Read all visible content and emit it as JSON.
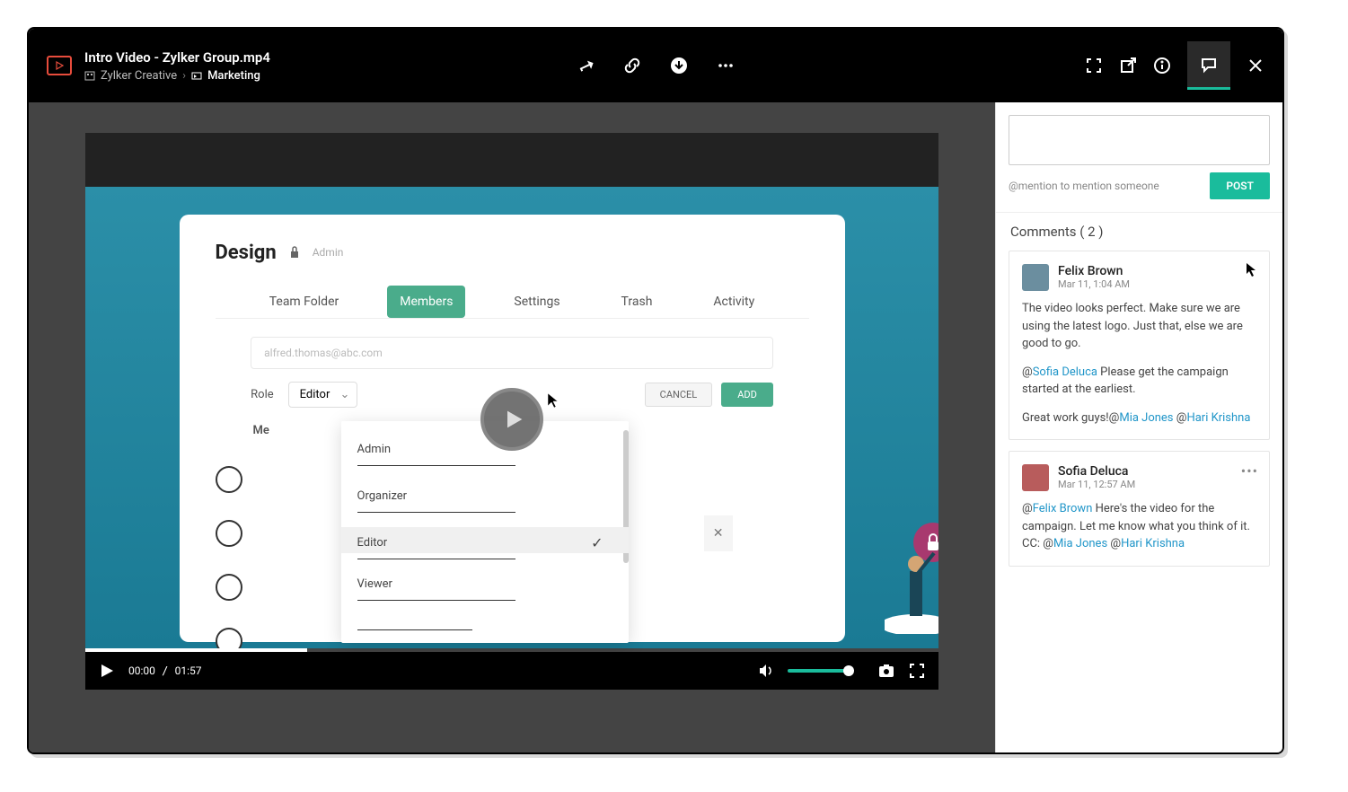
{
  "header": {
    "title": "Intro Video - Zylker Group.mp4",
    "breadcrumb": {
      "org": "Zylker Creative",
      "folder": "Marketing"
    }
  },
  "video": {
    "time_current": "00:00",
    "time_total": "01:57",
    "mock": {
      "title": "Design",
      "admin_label": "Admin",
      "tabs": [
        "Team Folder",
        "Members",
        "Settings",
        "Trash",
        "Activity"
      ],
      "active_tab": "Members",
      "input_placeholder": "alfred.thomas@abc.com",
      "role_label": "Role",
      "role_selected": "Editor",
      "cancel": "CANCEL",
      "add": "ADD",
      "members_label": "Me",
      "dropdown": [
        "Admin",
        "Organizer",
        "Editor",
        "Viewer"
      ]
    }
  },
  "comments": {
    "mention_hint": "@mention to mention someone",
    "post": "POST",
    "header": "Comments ( 2 )",
    "items": [
      {
        "author": "Felix Brown",
        "time": "Mar 11, 1:04 AM",
        "body_p1": "The video looks perfect. Make sure we are using the latest logo. Just that, else we are good to go.",
        "body_p2_pre": "@",
        "body_p2_mention": "Sofia Deluca",
        "body_p2_post": " Please get the campaign started at the earliest.",
        "body_p3_pre": "Great work guys!@",
        "body_p3_m1": "Mia Jones",
        "body_p3_mid": " @",
        "body_p3_m2": "Hari Krishna"
      },
      {
        "author": "Sofia Deluca",
        "time": "Mar 11, 12:57 AM",
        "body_pre": "@",
        "body_m1": "Felix Brown",
        "body_mid1": " Here's the video for the campaign. Let me know what you think of it. CC: @",
        "body_m2": "Mia Jones",
        "body_mid2": " @",
        "body_m3": "Hari Krishna"
      }
    ]
  }
}
